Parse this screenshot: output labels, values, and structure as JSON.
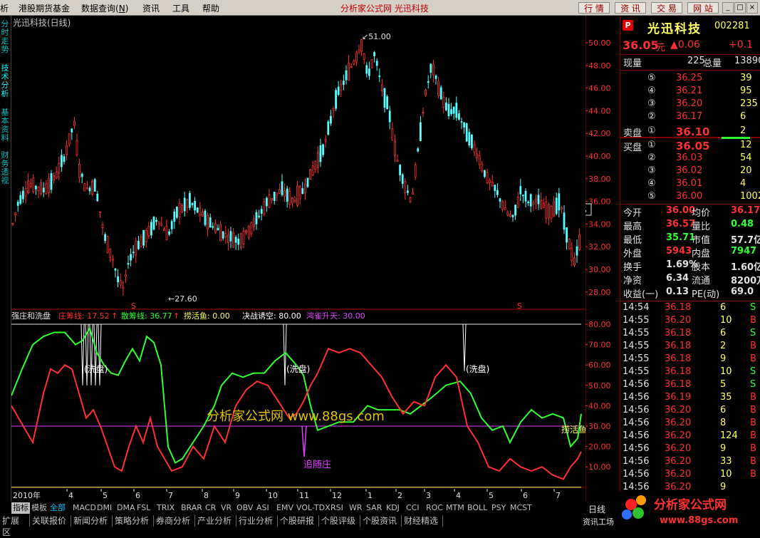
{
  "menu": [
    "析",
    "港股期货基金",
    "数据查询",
    "资讯",
    "工具",
    "帮助"
  ],
  "menu_hotkey": "N",
  "title_bar": "分析家公式网 光迅科技",
  "top_buttons": [
    "行 情",
    "资 讯",
    "交 易",
    "网 站"
  ],
  "left_tabs": [
    "分时走势",
    "技术分析",
    "基本资料",
    "财务透视"
  ],
  "kline": {
    "title": "光迅科技(日线)",
    "high_label": "51.00",
    "low_label": "27.60",
    "price_ticks": [
      "50.00",
      "48.00",
      "46.00",
      "44.00",
      "42.00",
      "40.00",
      "38.00",
      "36.00",
      "34.00",
      "32.00",
      "30.00",
      "28.00"
    ],
    "last_price_marker": "35",
    "s_marks": [
      "S",
      "S"
    ]
  },
  "indicator": {
    "name": "强庄和洗盘",
    "lines": [
      {
        "label": "庄筹线: 17.52",
        "color": "#ff3030"
      },
      {
        "label": "散筹线: 36.77",
        "color": "#30ff30"
      },
      {
        "label": "捞活鱼: 0.00",
        "color": "#ffff60"
      },
      {
        "label": "决战诱空: 80.00",
        "color": "#ffffff"
      },
      {
        "label": "鸿雀升天: 30.00",
        "color": "#e040ff"
      }
    ],
    "ticks": [
      "80.00",
      "70.00",
      "60.00",
      "50.00",
      "40.00",
      "30.00",
      "20.00",
      "10.00"
    ],
    "annotations": [
      "(洗盘)",
      "(洗盘)",
      "(洗盘)",
      "追随庄",
      "捞活鱼"
    ],
    "watermark": "分析家公式网 www.88gs.com"
  },
  "time_axis": {
    "year": "2010年",
    "months": [
      "4",
      "5",
      "6",
      "7",
      "8",
      "9",
      "10",
      "11",
      "12",
      "1",
      "2",
      "3",
      "4",
      "5",
      "6",
      "7"
    ],
    "period": "日线"
  },
  "quote": {
    "name": "光迅科技",
    "code": "002281",
    "price": "36.05",
    "unit": "元",
    "change": "▲0.06",
    "change_pct": "+0.1",
    "volume_label": "现量",
    "volume": "225",
    "total_label": "总量",
    "total": "13890",
    "asks": [
      {
        "lvl": "⑤",
        "price": "36.25",
        "vol": "39"
      },
      {
        "lvl": "④",
        "price": "36.21",
        "vol": "95"
      },
      {
        "lvl": "③",
        "price": "36.20",
        "vol": "235"
      },
      {
        "lvl": "②",
        "price": "36.17",
        "vol": "6"
      },
      {
        "lvl": "①",
        "price": "36.10",
        "vol": "2"
      }
    ],
    "ask_label": "卖盘",
    "bid_label": "买盘",
    "bids": [
      {
        "lvl": "①",
        "price": "36.05",
        "vol": "12"
      },
      {
        "lvl": "②",
        "price": "36.03",
        "vol": "54"
      },
      {
        "lvl": "③",
        "price": "36.02",
        "vol": "20"
      },
      {
        "lvl": "④",
        "price": "36.01",
        "vol": "4"
      },
      {
        "lvl": "⑤",
        "price": "36.00",
        "vol": "1002"
      }
    ],
    "stats": [
      {
        "k1": "今开",
        "v1": "36.00",
        "c1": "#ff3030",
        "k2": "均价",
        "v2": "36.17",
        "c2": "#ff3030"
      },
      {
        "k1": "最高",
        "v1": "36.57",
        "c1": "#ff3030",
        "k2": "量比",
        "v2": "0.48",
        "c2": "#30ff30"
      },
      {
        "k1": "最低",
        "v1": "35.71",
        "c1": "#30ff30",
        "k2": "市值",
        "v2": "57.7亿",
        "c2": "#e0e0e0"
      },
      {
        "k1": "外盘",
        "v1": "5943",
        "c1": "#ff3030",
        "k2": "内盘",
        "v2": "7947",
        "c2": "#30ff30"
      },
      {
        "k1": "换手",
        "v1": "1.69%",
        "c1": "#e0e0e0",
        "k2": "股本",
        "v2": "1.60亿",
        "c2": "#e0e0e0"
      },
      {
        "k1": "净资",
        "v1": "6.34",
        "c1": "#e0e0e0",
        "k2": "流通",
        "v2": "8200万",
        "c2": "#e0e0e0"
      },
      {
        "k1": "收益(一)",
        "v1": "0.13",
        "c1": "#e0e0e0",
        "k2": "PE(动)",
        "v2": "69.0",
        "c2": "#e0e0e0"
      }
    ],
    "ticks": [
      {
        "t": "14:54",
        "p": "36.18",
        "v": "6",
        "s": "S"
      },
      {
        "t": "14:55",
        "p": "36.20",
        "v": "10",
        "s": "B"
      },
      {
        "t": "14:55",
        "p": "36.18",
        "v": "6",
        "s": "S"
      },
      {
        "t": "14:55",
        "p": "36.18",
        "v": "2",
        "s": "B"
      },
      {
        "t": "14:55",
        "p": "36.18",
        "v": "9",
        "s": "B"
      },
      {
        "t": "14:55",
        "p": "36.18",
        "v": "10",
        "s": "S"
      },
      {
        "t": "14:56",
        "p": "36.18",
        "v": "5",
        "s": "S"
      },
      {
        "t": "14:56",
        "p": "36.19",
        "v": "35",
        "s": "B"
      },
      {
        "t": "14:56",
        "p": "36.20",
        "v": "6",
        "s": "B"
      },
      {
        "t": "14:56",
        "p": "36.20",
        "v": "8",
        "s": "B"
      },
      {
        "t": "14:56",
        "p": "36.20",
        "v": "124",
        "s": "B"
      },
      {
        "t": "14:56",
        "p": "36.20",
        "v": "9",
        "s": "B"
      },
      {
        "t": "14:56",
        "p": "36.20",
        "v": "33",
        "s": "B"
      },
      {
        "t": "14:56",
        "p": "36.20",
        "v": "10",
        "s": "B"
      },
      {
        "t": "14:56",
        "p": "36.20",
        "v": "9",
        "s": ""
      }
    ]
  },
  "indicator_tabs": [
    "指标",
    "模板",
    "全部",
    "MACD",
    "DMI",
    "DMA",
    "FSL",
    "TRIX",
    "BRAR",
    "CR",
    "VR",
    "OBV",
    "ASI",
    "EMV",
    "VOL-TDX",
    "RSI",
    "WR",
    "SAR",
    "KDJ",
    "CCI",
    "ROC",
    "MTM",
    "BOLL",
    "PSY",
    "MCST"
  ],
  "bottom_tabs": [
    "扩展区",
    "关联报价",
    "新闻分析",
    "策略分析",
    "券商分析",
    "产业分析",
    "行业分析",
    "个股研报",
    "个股评级",
    "个股资讯",
    "财经精选"
  ],
  "right_corner_tab": "资讯工场",
  "logo_text": "分析家公式网",
  "logo_url": "www.88gs.com",
  "colors": {
    "up": "#ff3030",
    "down": "#54ffff",
    "accent": "#c00000"
  }
}
